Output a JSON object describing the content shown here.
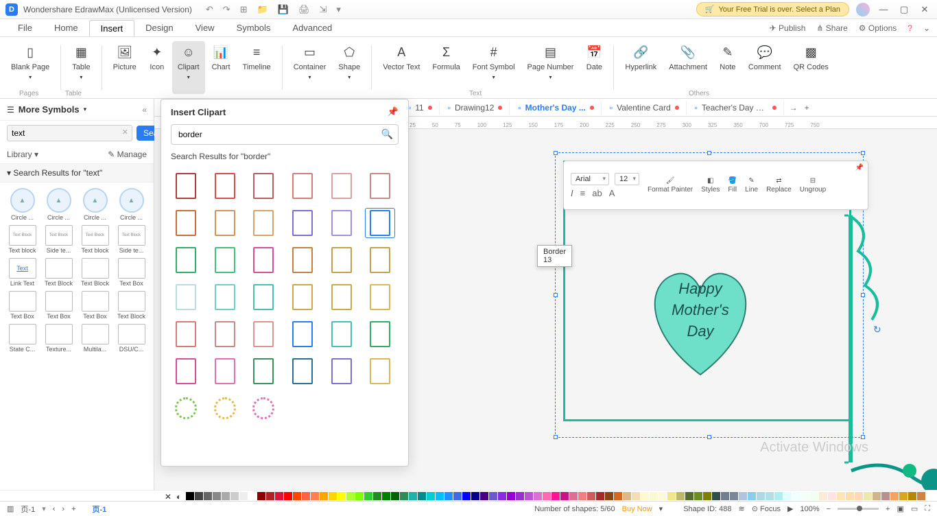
{
  "title": "Wondershare EdrawMax (Unlicensed Version)",
  "trial_msg": "Your Free Trial is over. Select a Plan",
  "menus": [
    "File",
    "Home",
    "Insert",
    "Design",
    "View",
    "Symbols",
    "Advanced"
  ],
  "menu_right": {
    "publish": "Publish",
    "share": "Share",
    "options": "Options"
  },
  "ribbon": {
    "blank": "Blank\nPage",
    "table": "Table",
    "picture": "Picture",
    "icon": "Icon",
    "clipart": "Clipart",
    "chart": "Chart",
    "timeline": "Timeline",
    "container": "Container",
    "shape": "Shape",
    "vectortext": "Vector\nText",
    "formula": "Formula",
    "fontsymbol": "Font\nSymbol",
    "pagenumber": "Page\nNumber",
    "date": "Date",
    "hyperlink": "Hyperlink",
    "attachment": "Attachment",
    "note": "Note",
    "comment": "Comment",
    "qr": "QR\nCodes",
    "group_pages": "Pages",
    "group_table": "Table",
    "group_text": "Text",
    "group_others": "Others"
  },
  "left_panel": {
    "title": "More Symbols",
    "search_value": "text",
    "search_btn": "Search",
    "library": "Library",
    "manage": "Manage",
    "section": "Search Results for  \"text\"",
    "shapes": [
      {
        "label": "Circle ..."
      },
      {
        "label": "Circle ..."
      },
      {
        "label": "Circle ..."
      },
      {
        "label": "Circle ..."
      },
      {
        "label": "Text block"
      },
      {
        "label": "Side te..."
      },
      {
        "label": "Text block"
      },
      {
        "label": "Side te..."
      },
      {
        "label": "Link Text"
      },
      {
        "label": "Text Block"
      },
      {
        "label": "Text Block"
      },
      {
        "label": "Text Box"
      },
      {
        "label": "Text Box"
      },
      {
        "label": "Text Box"
      },
      {
        "label": "Text Box"
      },
      {
        "label": "Text Block"
      },
      {
        "label": "State C..."
      },
      {
        "label": "Texture..."
      },
      {
        "label": "Multila..."
      },
      {
        "label": "DSU/C..."
      }
    ]
  },
  "clipart": {
    "title": "Insert Clipart",
    "search_value": "border",
    "results_label": "Search Results for  \"border\"",
    "tooltip": "Border 13",
    "borders": [
      "#b23a3a",
      "#d94c4c",
      "#b85c5c",
      "#d97a7a",
      "#d9a0a0",
      "#c48888",
      "#c96d3e",
      "#d4925a",
      "#d6a26e",
      "#7e6fcf",
      "#a48ed9",
      "#2a7cf3",
      "#2fae66",
      "#45c07a",
      "#d94c9a",
      "#c77e3e",
      "#c4a04a",
      "#c4a04a",
      "#b8dce0",
      "#6fcfc4",
      "#45c0b5",
      "#c9a94a",
      "#c9a94a",
      "#d9b85a",
      "#d97a7a",
      "#c48888",
      "#d99494",
      "#2a7cf3",
      "#45c0b5",
      "#2fae66",
      "#d94c9a",
      "#e070b0",
      "#3a8f5a",
      "#2a6f8f",
      "#7e6fcf",
      "#d9b85a",
      "#7ac943",
      "#e5b84a",
      "#e070b0"
    ],
    "selected_index": 11
  },
  "tabs": [
    {
      "label": "11"
    },
    {
      "label": "Drawing12"
    },
    {
      "label": "Mother's Day ...",
      "active": true
    },
    {
      "label": "Valentine Card"
    },
    {
      "label": "Teacher's Day G..."
    }
  ],
  "ruler_marks": [
    "25",
    "50",
    "75",
    "100",
    "125",
    "150",
    "175",
    "200",
    "225",
    "250",
    "275",
    "300",
    "325",
    "350",
    "700",
    "725",
    "750"
  ],
  "float_toolbar": {
    "font": "Arial",
    "size": "12",
    "format_painter": "Format\nPainter",
    "styles": "Styles",
    "fill": "Fill",
    "line": "Line",
    "replace": "Replace",
    "ungroup": "Ungroup"
  },
  "heart_text": {
    "l1": "Happy",
    "l2": "Mother's",
    "l3": "Day"
  },
  "watermark": "Activate Windows",
  "status": {
    "page_label": "页-1",
    "page_tab": "页-1",
    "shapes": "Number of shapes: 5/60",
    "buy": "Buy Now",
    "shape_id": "Shape ID: 488",
    "focus": "Focus",
    "zoom": "100%"
  },
  "color_strip": [
    "#000",
    "#444",
    "#666",
    "#888",
    "#aaa",
    "#ccc",
    "#eee",
    "#fff",
    "#8b0000",
    "#b22222",
    "#dc143c",
    "#ff0000",
    "#ff4500",
    "#ff6347",
    "#ff7f50",
    "#ffa500",
    "#ffd700",
    "#ffff00",
    "#adff2f",
    "#7fff00",
    "#32cd32",
    "#228b22",
    "#008000",
    "#006400",
    "#2e8b57",
    "#20b2aa",
    "#008b8b",
    "#00ced1",
    "#00bfff",
    "#1e90ff",
    "#4169e1",
    "#0000ff",
    "#00008b",
    "#4b0082",
    "#6a5acd",
    "#8a2be2",
    "#9400d3",
    "#9932cc",
    "#ba55d3",
    "#da70d6",
    "#ff69b4",
    "#ff1493",
    "#c71585",
    "#db7093",
    "#f08080",
    "#cd5c5c",
    "#a52a2a",
    "#8b4513",
    "#d2691e",
    "#deb887",
    "#f5deb3",
    "#fffacd",
    "#fafad2",
    "#fff8dc",
    "#f0e68c",
    "#bdb76b",
    "#556b2f",
    "#6b8e23",
    "#808000",
    "#2f4f4f",
    "#708090",
    "#778899",
    "#b0c4de",
    "#87ceeb",
    "#add8e6",
    "#b0e0e6",
    "#afeeee",
    "#e0ffff",
    "#f0ffff",
    "#f5fffa",
    "#f0fff0",
    "#faebd7",
    "#ffe4e1",
    "#ffe4b5",
    "#ffdead",
    "#ffdab9",
    "#eee8aa",
    "#d2b48c",
    "#bc8f8f",
    "#f4a460",
    "#daa520",
    "#b8860b",
    "#cd853f"
  ]
}
